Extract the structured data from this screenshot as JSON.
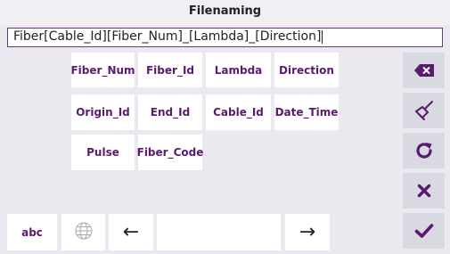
{
  "title": "Filenaming",
  "filename_value": "Fiber[Cable_Id][Fiber_Num]_[Lambda]_[Direction]",
  "keys": {
    "fiber_num": "Fiber_Num",
    "fiber_id": "Fiber_Id",
    "lambda": "Lambda",
    "direction": "Direction",
    "origin_id": "Origin_Id",
    "end_id": "End_Id",
    "cable_id": "Cable_Id",
    "date_time": "Date_Time",
    "pulse": "Pulse",
    "fiber_code": "Fiber_Code"
  },
  "bottom": {
    "abc": "abc",
    "left_arrow": "←",
    "right_arrow": "→"
  },
  "icons": {
    "side": [
      "backspace-icon",
      "clear-broom-icon",
      "refresh-icon",
      "close-icon",
      "confirm-check-icon"
    ],
    "bottom": "globe-icon"
  },
  "colors": {
    "accent": "#5a1a6e",
    "background": "#e9e9ef",
    "side_button": "#d9d9e1",
    "key": "#ffffff"
  }
}
